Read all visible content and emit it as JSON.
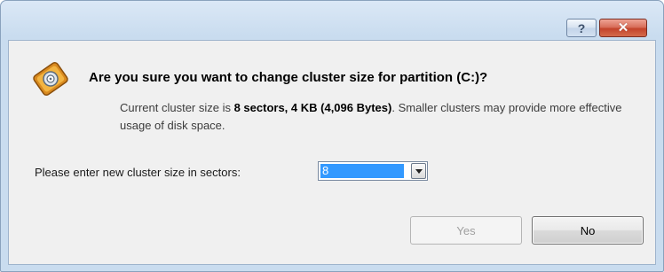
{
  "titlebar": {
    "help_label": "?",
    "close_label": "✕"
  },
  "dialog": {
    "icon": "disk-partition-icon",
    "question": "Are you sure you want to change cluster size for partition (C:)?",
    "info_prefix": "Current cluster size is ",
    "info_bold": "8 sectors, 4 KB (4,096 Bytes)",
    "info_suffix": ". Smaller clusters may provide more effective usage of disk space.",
    "prompt_label": "Please enter new cluster size in sectors:",
    "cluster_size_value": "8",
    "yes_label": "Yes",
    "no_label": "No"
  },
  "colors": {
    "window_frame": "#c9dcef",
    "client_bg": "#f0f0f0",
    "selection": "#3399ff",
    "close_red": "#c3432b"
  }
}
